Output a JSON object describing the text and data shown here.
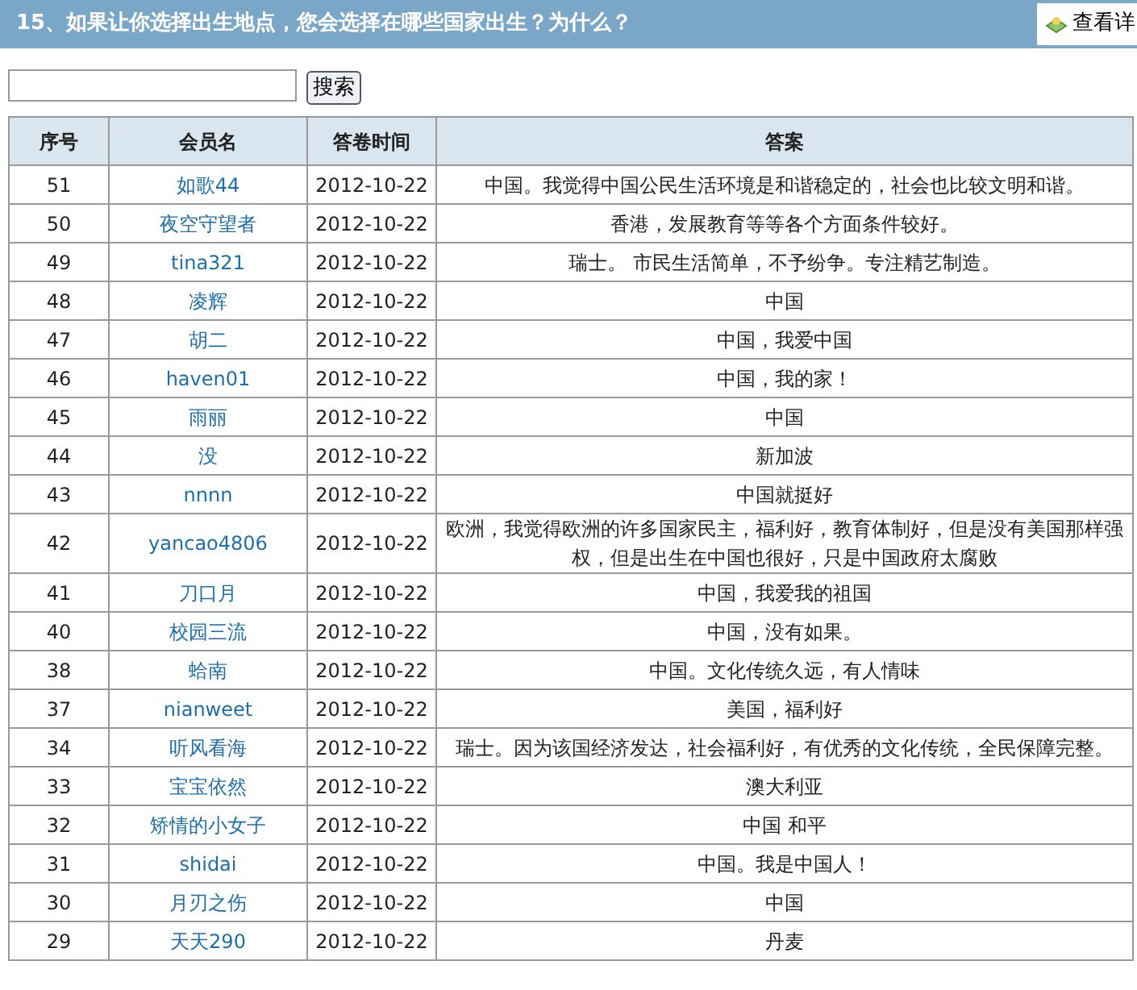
{
  "title": "15、如果让你选择出生地点，您会选择在哪些国家出生？为什么？",
  "detail_button": "查看详",
  "search": {
    "button": "搜索"
  },
  "table": {
    "columns": [
      "序号",
      "会员名",
      "答卷时间",
      "答案"
    ],
    "rows": [
      {
        "no": "51",
        "member": "如歌44",
        "time": "2012-10-22",
        "answer": "中国。我觉得中国公民生活环境是和谐稳定的，社会也比较文明和谐。"
      },
      {
        "no": "50",
        "member": "夜空守望者",
        "time": "2012-10-22",
        "answer": "香港，发展教育等等各个方面条件较好。"
      },
      {
        "no": "49",
        "member": "tina321",
        "time": "2012-10-22",
        "answer": "瑞士。 市民生活简单，不予纷争。专注精艺制造。"
      },
      {
        "no": "48",
        "member": "凌辉",
        "time": "2012-10-22",
        "answer": "中国"
      },
      {
        "no": "47",
        "member": "胡二",
        "time": "2012-10-22",
        "answer": "中国，我爱中国"
      },
      {
        "no": "46",
        "member": "haven01",
        "time": "2012-10-22",
        "answer": "中国，我的家！"
      },
      {
        "no": "45",
        "member": "雨丽",
        "time": "2012-10-22",
        "answer": "中国"
      },
      {
        "no": "44",
        "member": "没",
        "time": "2012-10-22",
        "answer": "新加波"
      },
      {
        "no": "43",
        "member": "nnnn",
        "time": "2012-10-22",
        "answer": "中国就挺好"
      },
      {
        "no": "42",
        "member": "yancao4806",
        "time": "2012-10-22",
        "answer": "欧洲，我觉得欧洲的许多国家民主，福利好，教育体制好，但是没有美国那样强权，但是出生在中国也很好，只是中国政府太腐败"
      },
      {
        "no": "41",
        "member": "刀口月",
        "time": "2012-10-22",
        "answer": "中国，我爱我的祖国"
      },
      {
        "no": "40",
        "member": "校园三流",
        "time": "2012-10-22",
        "answer": "中国，没有如果。"
      },
      {
        "no": "38",
        "member": "蛤南",
        "time": "2012-10-22",
        "answer": "中国。文化传统久远，有人情味"
      },
      {
        "no": "37",
        "member": "nianweet",
        "time": "2012-10-22",
        "answer": "美国，福利好"
      },
      {
        "no": "34",
        "member": "听风看海",
        "time": "2012-10-22",
        "answer": "瑞士。因为该国经济发达，社会福利好，有优秀的文化传统，全民保障完整。"
      },
      {
        "no": "33",
        "member": "宝宝依然",
        "time": "2012-10-22",
        "answer": "澳大利亚"
      },
      {
        "no": "32",
        "member": "矫情的小女子",
        "time": "2012-10-22",
        "answer": "中国 和平"
      },
      {
        "no": "31",
        "member": "shidai",
        "time": "2012-10-22",
        "answer": "中国。我是中国人！"
      },
      {
        "no": "30",
        "member": "月刃之伤",
        "time": "2012-10-22",
        "answer": "中国"
      },
      {
        "no": "29",
        "member": "天天290",
        "time": "2012-10-22",
        "answer": "丹麦"
      }
    ]
  }
}
